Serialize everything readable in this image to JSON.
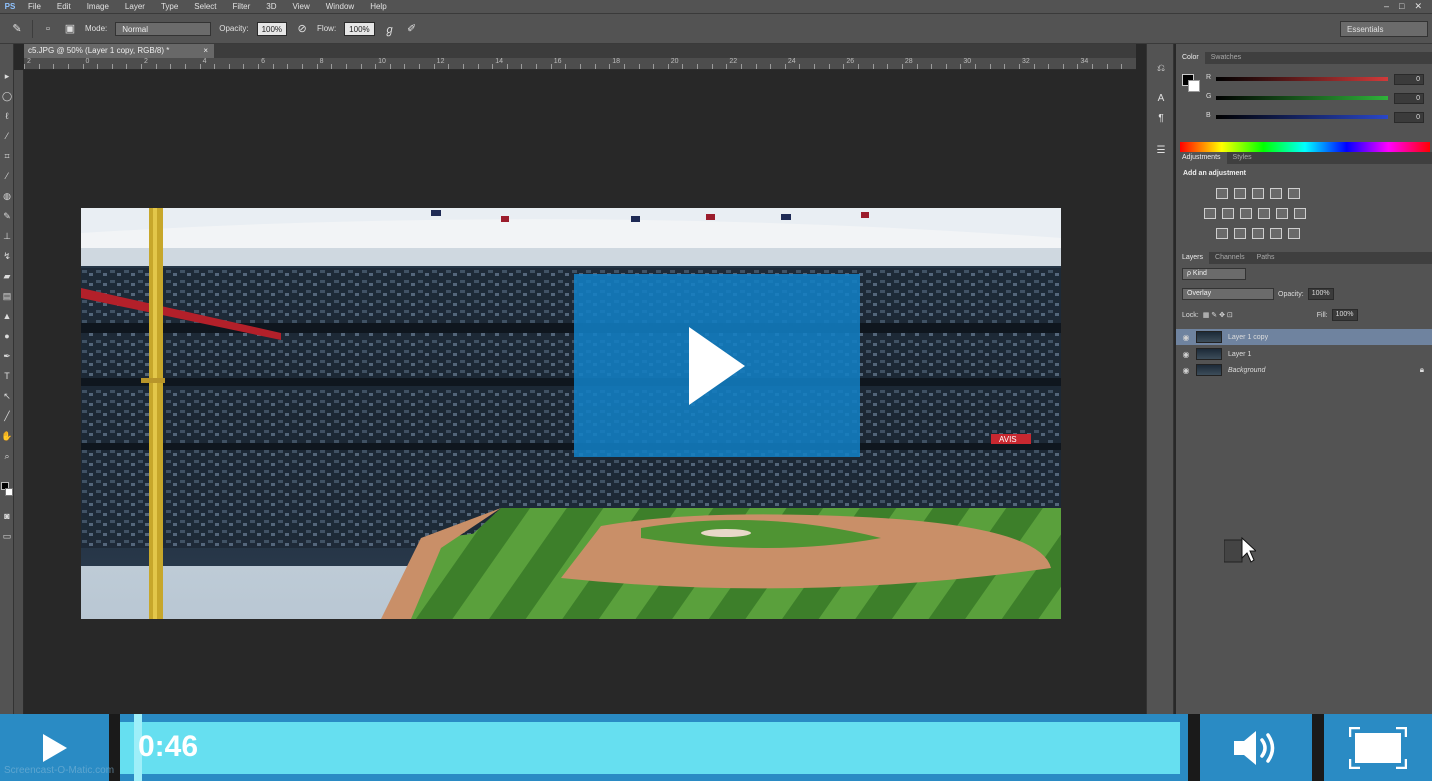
{
  "app": {
    "logo": "PS",
    "menu": [
      "File",
      "Edit",
      "Image",
      "Layer",
      "Type",
      "Select",
      "Filter",
      "3D",
      "View",
      "Window",
      "Help"
    ],
    "window_controls": [
      "–",
      "□",
      "✕"
    ]
  },
  "options_bar": {
    "mode_label": "Mode:",
    "mode_value": "Normal",
    "opacity_label": "Opacity:",
    "opacity_value": "100%",
    "flow_label": "Flow:",
    "flow_value": "100%",
    "workspace": "Essentials"
  },
  "document": {
    "tab_title": "c5.JPG @ 50% (Layer 1 copy, RGB/8) *",
    "close": "×",
    "ruler_marks": [
      "2",
      "0",
      "2",
      "4",
      "6",
      "8",
      "10",
      "12",
      "14",
      "16",
      "18",
      "20",
      "22",
      "24",
      "26",
      "28",
      "30",
      "32",
      "34"
    ]
  },
  "panels": {
    "color": {
      "tabs": [
        "Color",
        "Swatches"
      ],
      "channels": [
        {
          "name": "R",
          "value": "0",
          "color": "#d13a3a"
        },
        {
          "name": "G",
          "value": "0",
          "color": "#2fb33a"
        },
        {
          "name": "B",
          "value": "0",
          "color": "#2a47c8"
        }
      ]
    },
    "adjustments": {
      "tabs": [
        "Adjustments",
        "Styles"
      ],
      "title": "Add an adjustment"
    },
    "layers": {
      "tabs": [
        "Layers",
        "Channels",
        "Paths"
      ],
      "kind_label": "ρ Kind",
      "blend_mode": "Overlay",
      "opacity_label": "Opacity:",
      "opacity_value": "100%",
      "lock_label": "Lock:",
      "fill_label": "Fill:",
      "fill_value": "100%",
      "items": [
        {
          "name": "Layer 1 copy",
          "selected": true
        },
        {
          "name": "Layer 1",
          "selected": false
        },
        {
          "name": "Background",
          "selected": false,
          "locked": true
        }
      ]
    }
  },
  "canvas_labels": {
    "avis": "AVIS"
  },
  "video": {
    "time": "0:46",
    "progress": 0.013,
    "watermark": "Screencast-O-Matic.com",
    "accent": "#2a8bc4",
    "progress_color": "#66dff0"
  },
  "icons": [
    "play-icon",
    "volume-icon",
    "fullscreen-icon",
    "brush-icon",
    "eye-icon",
    "lock-icon"
  ]
}
